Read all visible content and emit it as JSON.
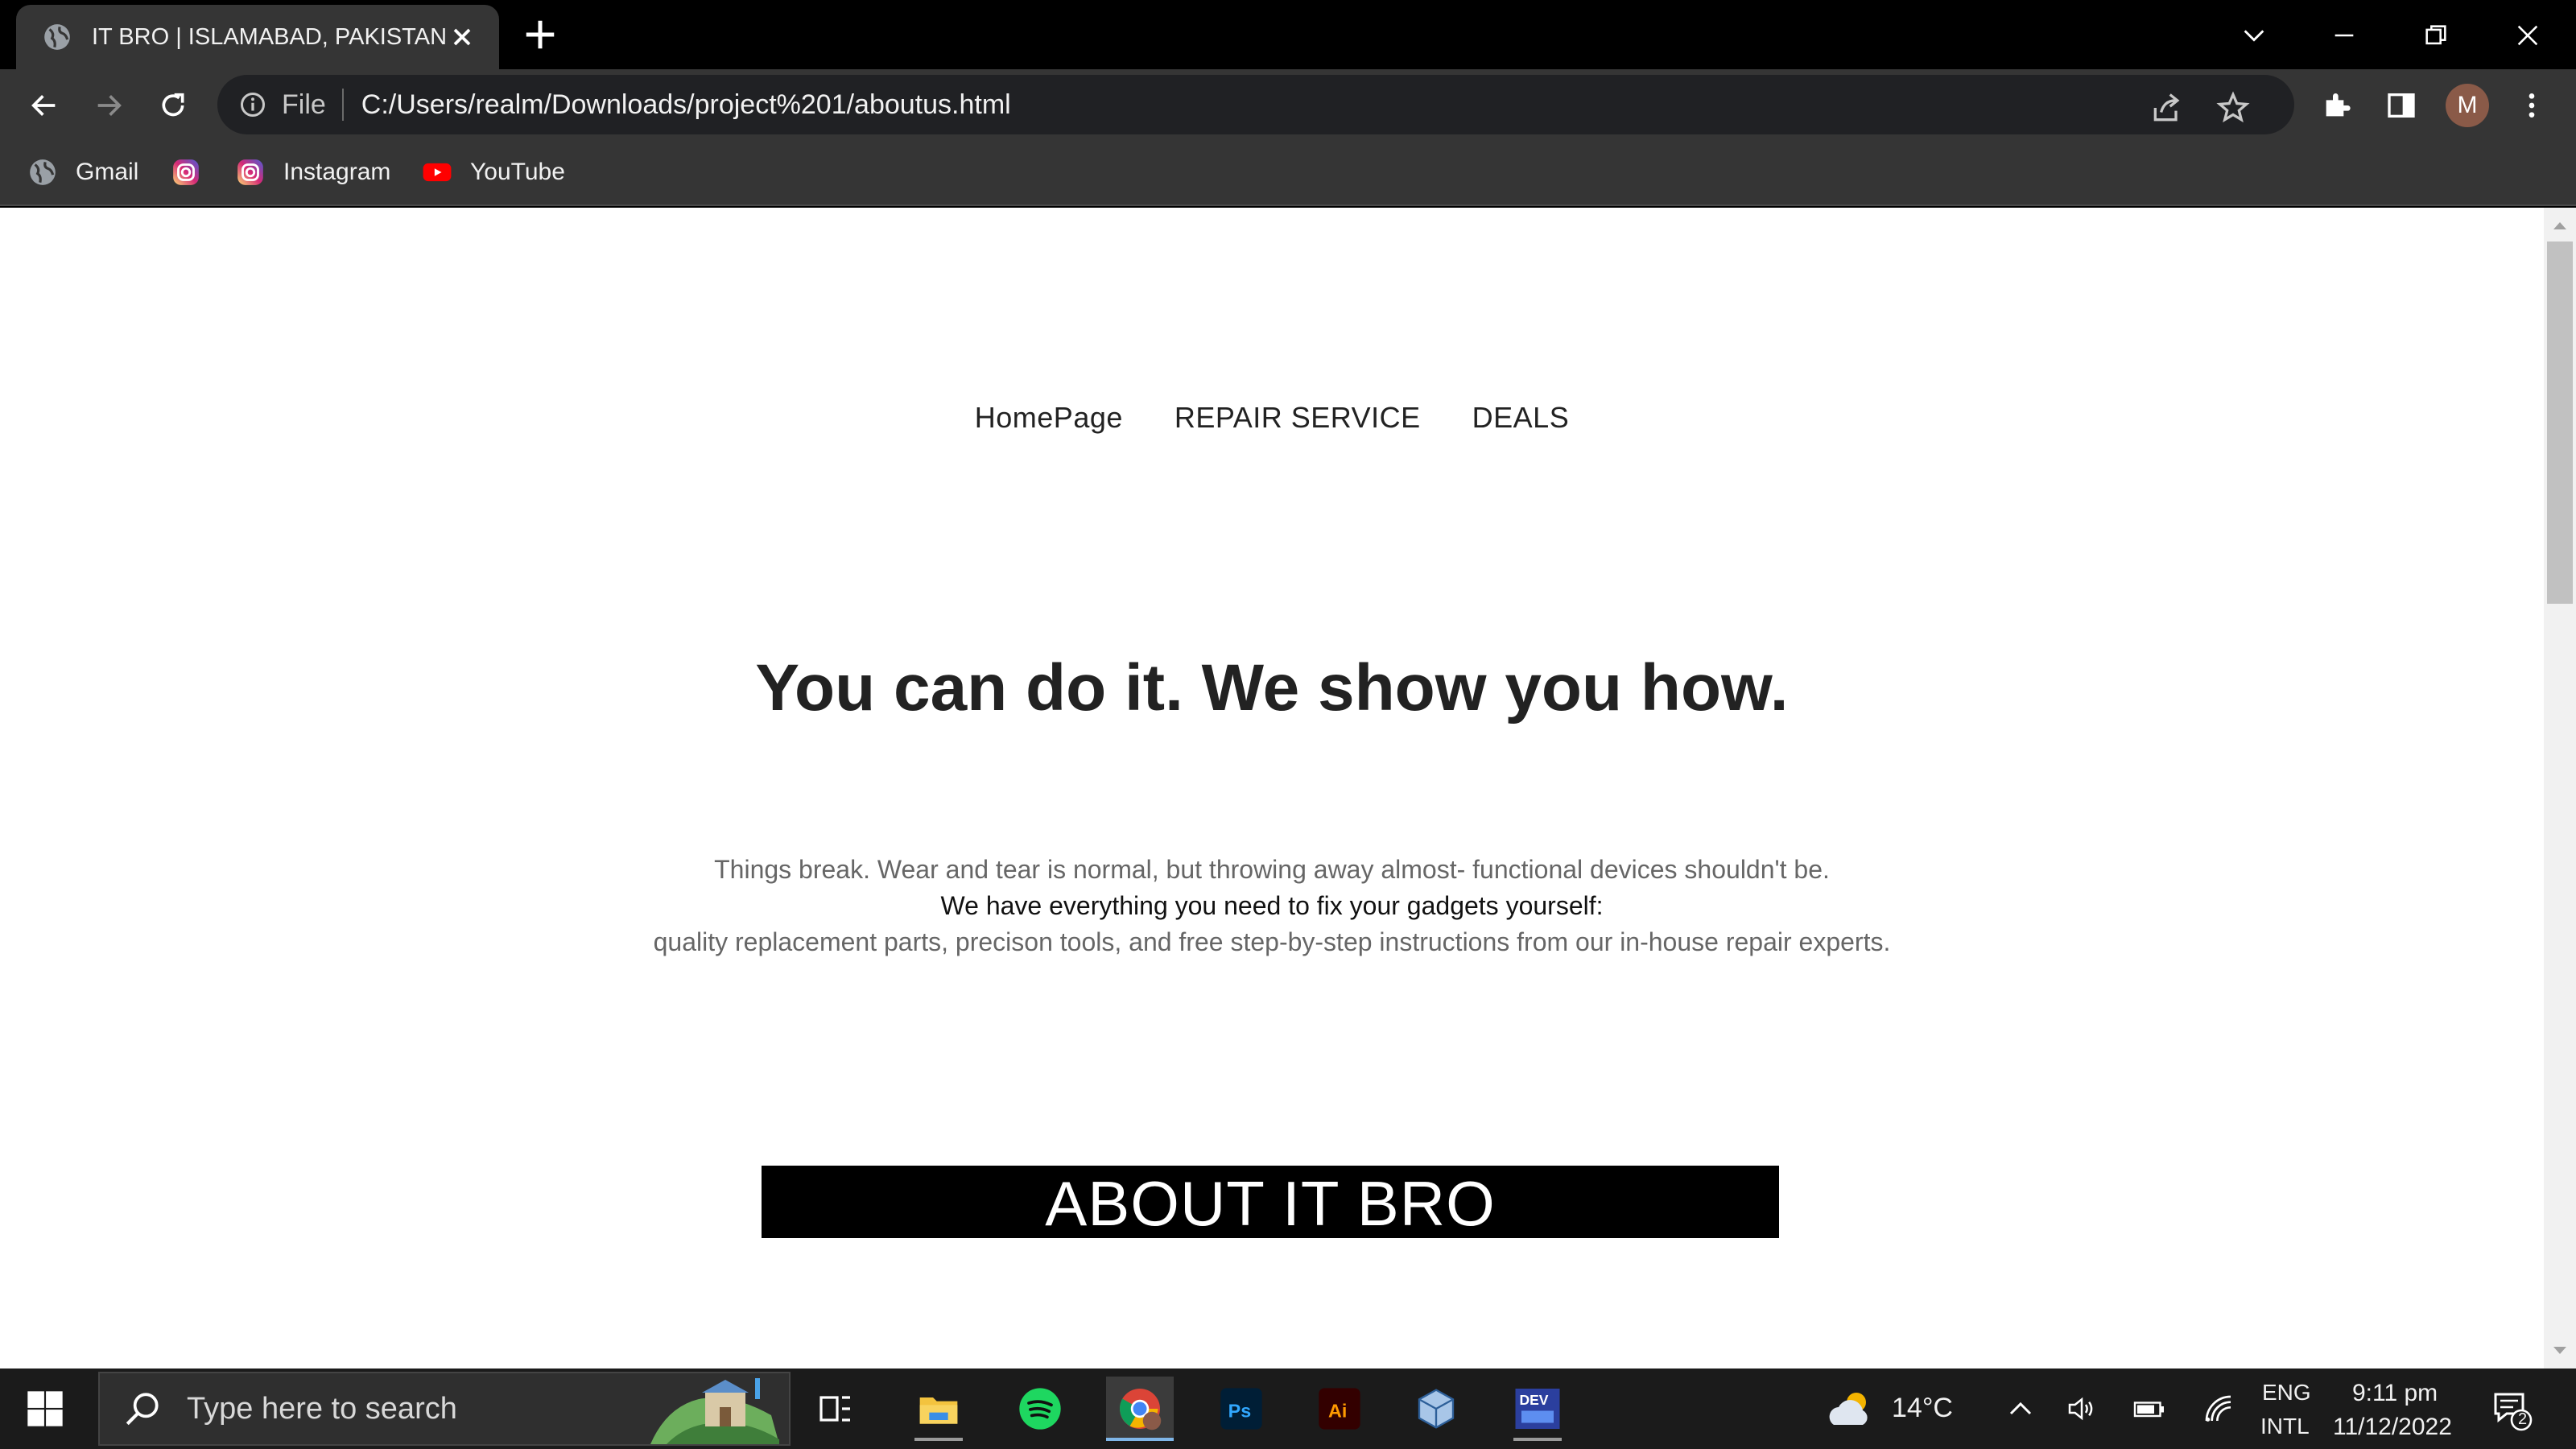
{
  "browser": {
    "tab_title": "IT BRO | ISLAMABAD, PAKISTAN",
    "address_prefix": "File",
    "url": "C:/Users/realm/Downloads/project%201/aboutus.html",
    "profile_initial": "M"
  },
  "bookmarks": [
    {
      "label": "Gmail",
      "icon": "globe-icon"
    },
    {
      "label": "",
      "icon": "instagram-icon"
    },
    {
      "label": "Instagram",
      "icon": "instagram-icon"
    },
    {
      "label": "YouTube",
      "icon": "youtube-icon"
    }
  ],
  "page": {
    "nav": [
      "HomePage",
      "REPAIR SERVICE",
      "DEALS"
    ],
    "hero_title": "You can do it. We show you how.",
    "description": {
      "line1": "Things break. Wear and tear is normal, but throwing away almost- functional devices shouldn't be.",
      "line2": "We have everything you need to fix your gadgets yourself:",
      "line3": "quality replacement parts, precison tools, and free step-by-step instructions from our in-house repair experts."
    },
    "about_heading": "ABOUT IT BRO"
  },
  "taskbar": {
    "search_placeholder": "Type here to search",
    "apps": [
      "task-view",
      "file-explorer",
      "spotify",
      "chrome",
      "photoshop",
      "illustrator",
      "virtualbox",
      "dev-cpp"
    ],
    "weather_temp": "14°C",
    "language": "ENG",
    "keyboard": "INTL",
    "time": "9:11 pm",
    "date": "11/12/2022",
    "notification_count": "2"
  },
  "colors": {
    "chrome_dark": "#353535",
    "omnibox": "#202124",
    "about_bar": "#000000"
  }
}
